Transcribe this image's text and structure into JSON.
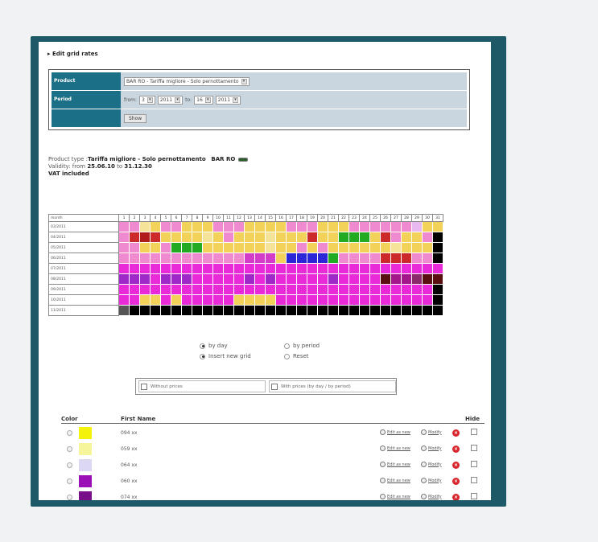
{
  "page_title": "Edit grid rates",
  "form": {
    "product_label": "Product",
    "product_value": "BAR RO - Tariffa migliore - Solo pernottamento",
    "period_label": "Period",
    "from_label": "from:",
    "from_day": "3",
    "from_year": "2011",
    "to_label": "to:",
    "to_day": "16",
    "to_year": "2011",
    "show_button": "Show"
  },
  "info": {
    "product_type_label": "Product type :",
    "product_type_value": "Tariffa migliore - Solo pernottamento",
    "product_code": "BAR RO",
    "validity_label": "Validity: from",
    "validity_from": "25.06.10",
    "validity_to_label": "to",
    "validity_to": "31.12.30",
    "vat": "VAT included"
  },
  "grid": {
    "header_label": "month",
    "months": [
      "03/2011",
      "04/2011",
      "05/2011",
      "06/2011",
      "07/2011",
      "08/2011",
      "09/2011",
      "10/2011",
      "11/2011"
    ],
    "day_count": 31,
    "palette": {
      "a": "#e82ad8",
      "b": "#f05ae6",
      "c": "#d23cc8",
      "d": "#cc2a2a",
      "e": "#b01c1c",
      "f": "#f3d25a",
      "g": "#f6e39a",
      "h": "#f08ad0",
      "i": "#9f28c8",
      "j": "#7b1a8e",
      "k": "#2b27d6",
      "l": "#22aa22",
      "m": "#a3178a",
      "n": "#8a2a6a",
      "o": "#5a1010",
      "p": "#e8b8f0",
      "x": "#000000",
      "y": "#555555",
      "w": "#ffffff"
    },
    "rows": [
      "hhgfhhfffhhhffffhhhfffhhhhhhpff",
      "hdedffffgfhfffgfffdfflllfdhffhx",
      "hhffhlllffffffgffhfhffffffgfffx",
      "hhhhhhhhhhhhcccfkkkklhhhhdddhhx",
      "aaaaaaaaaaaaaaaaaaaaaaaaaaaaaaa",
      "iiiaiiiaaaaaiaiaaaaaiaaaaommnoo",
      "aaaaaaaaaaaaaaaaaaaaaaaaaaaaaax",
      "aaffafaaaaaffffaaaaaaaaaaaaaaax",
      "yxxxxxxxxxxxxxxxxxxxxxxxxxxxxxx"
    ]
  },
  "radios": {
    "by_day": "by day",
    "by_period": "by period",
    "insert_new_grid": "Insert new grid",
    "reset": "Reset"
  },
  "checkboxes": {
    "without_prices": "Without prices",
    "with_prices": "With prices (by day / by period)"
  },
  "list": {
    "color_header": "Color",
    "name_header": "First Name",
    "hide_header": "Hide",
    "edit_label": "Edit as new",
    "modify_label": "Modify",
    "rows": [
      {
        "name": "094 xx",
        "color": "#f4f20a"
      },
      {
        "name": "059 xx",
        "color": "#f7f59c"
      },
      {
        "name": "064 xx",
        "color": "#dcd8f4"
      },
      {
        "name": "060 xx",
        "color": "#9a10b6"
      },
      {
        "name": "074 xx",
        "color": "#7a0e8a"
      }
    ]
  }
}
